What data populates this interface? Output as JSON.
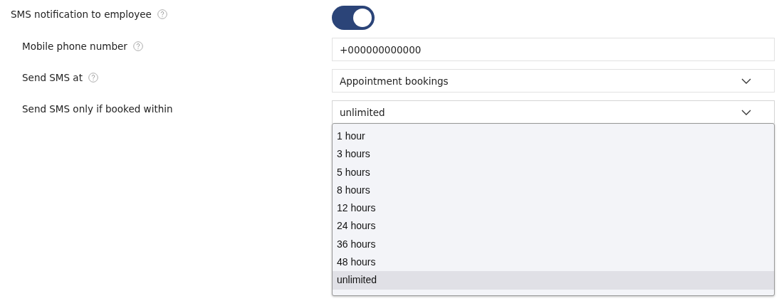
{
  "rows": [
    {
      "kind": "toggle",
      "label": "SMS notification to employee",
      "help": true,
      "indent": false,
      "on": true
    },
    {
      "kind": "text",
      "label": "Mobile phone number",
      "help": true,
      "indent": true,
      "value": "+000000000000"
    },
    {
      "kind": "select",
      "label": "Send SMS at",
      "help": true,
      "indent": true,
      "value": "Appointment bookings",
      "expanded": false
    },
    {
      "kind": "select",
      "label": "Send SMS only if booked within",
      "help": false,
      "indent": true,
      "value": "unlimited",
      "expanded": true,
      "options": [
        {
          "label": "1 hour",
          "selected": false
        },
        {
          "label": "3 hours",
          "selected": false
        },
        {
          "label": "5 hours",
          "selected": false
        },
        {
          "label": "8 hours",
          "selected": false
        },
        {
          "label": "12 hours",
          "selected": false
        },
        {
          "label": "24 hours",
          "selected": false
        },
        {
          "label": "36 hours",
          "selected": false
        },
        {
          "label": "48 hours",
          "selected": false
        },
        {
          "label": "unlimited",
          "selected": true
        }
      ]
    }
  ]
}
